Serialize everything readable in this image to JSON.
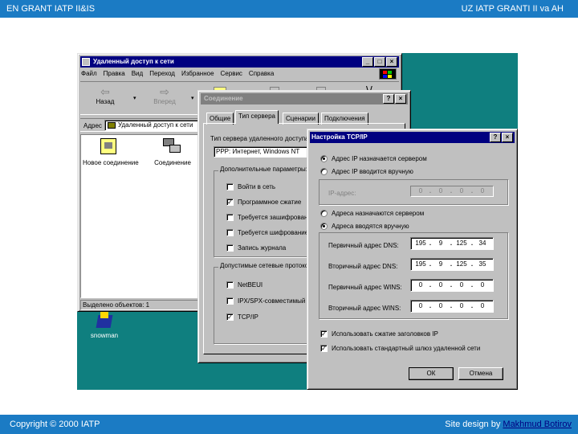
{
  "slide": {
    "header_left": "EN GRANT IATP II&IS",
    "header_right": "UZ IATP GRANTI II va AH",
    "footer_left": "Copyright © 2000 IATP",
    "footer_right_prefix": "Site design by ",
    "footer_right_link": "Makhmud Botirov"
  },
  "explorer": {
    "title": "Удаленный доступ к сети",
    "menu": [
      "Файл",
      "Правка",
      "Вид",
      "Переход",
      "Избранное",
      "Сервис",
      "Справка"
    ],
    "toolbar": {
      "back": "Назад",
      "forward": "Вперед"
    },
    "address_label": "Адрес",
    "address_value": "Удаленный доступ к сети",
    "icons": [
      {
        "label": "Новое соединение"
      },
      {
        "label": "Соединение"
      }
    ],
    "status": "Выделено объектов: 1"
  },
  "desktop_icon": {
    "label": "snowman"
  },
  "connection_dialog": {
    "title": "Соединение",
    "tabs": [
      "Общие",
      "Тип сервера",
      "Сценарии",
      "Подключения"
    ],
    "server_type_label": "Тип сервера удаленного доступа:",
    "server_type_value": "PPP: Интернет, Windows NT",
    "options_group": "Дополнительные параметры:",
    "options": [
      {
        "label": "Войти в сеть",
        "checked": false
      },
      {
        "label": "Программное сжатие",
        "checked": true
      },
      {
        "label": "Требуется зашифрованный",
        "checked": false
      },
      {
        "label": "Требуется шифрование",
        "checked": false
      },
      {
        "label": "Запись журнала",
        "checked": false
      }
    ],
    "protocols_group": "Допустимые сетевые протоколы:",
    "protocols": [
      {
        "label": "NetBEUI",
        "checked": false
      },
      {
        "label": "IPX/SPX-совместимый",
        "checked": false
      },
      {
        "label": "TCP/IP",
        "checked": true
      }
    ]
  },
  "tcpip_dialog": {
    "title": "Настройка TCP/IP",
    "help_btn": "?",
    "close_btn": "×",
    "ip_radio_server": "Адрес IP назначается сервером",
    "ip_radio_manual": "Адрес IP вводится вручную",
    "ip_label": "IP-адрес:",
    "ip_value": [
      "0",
      "0",
      "0",
      "0"
    ],
    "dns_radio_server": "Адреса назначаются сервером",
    "dns_radio_manual": "Адреса вводятся вручную",
    "rows": [
      {
        "label": "Первичный адрес DNS:",
        "value": [
          "195",
          "9",
          "125",
          "34"
        ]
      },
      {
        "label": "Вторичный адрес DNS:",
        "value": [
          "195",
          "9",
          "125",
          "35"
        ]
      },
      {
        "label": "Первичный адрес WINS:",
        "value": [
          "0",
          "0",
          "0",
          "0"
        ]
      },
      {
        "label": "Вторичный адрес WINS:",
        "value": [
          "0",
          "0",
          "0",
          "0"
        ]
      }
    ],
    "check_header_compression": "Использовать сжатие заголовков IP",
    "check_default_gateway": "Использовать стандартный шлюз удаленной сети",
    "ok": "ОК",
    "cancel": "Отмена"
  }
}
